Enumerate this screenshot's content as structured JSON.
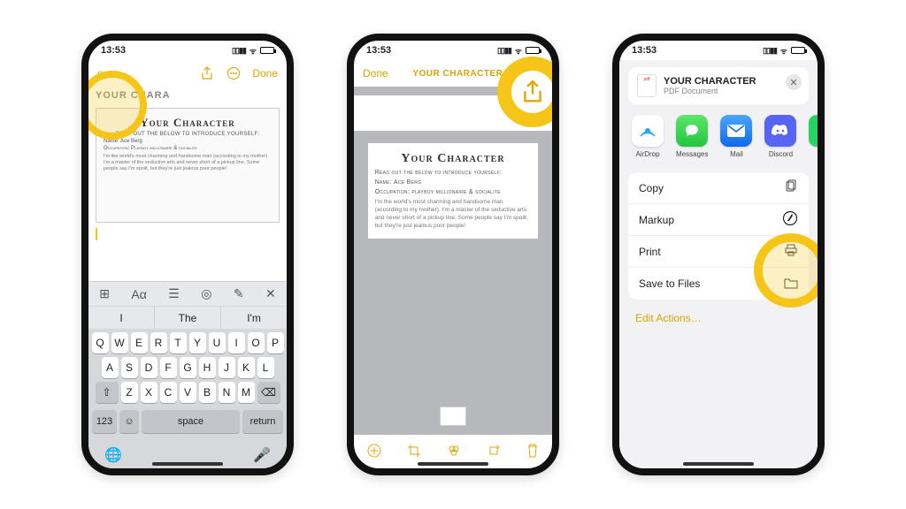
{
  "status": {
    "time": "13:53"
  },
  "phone1": {
    "topbar": {
      "left": "e",
      "done": "Done"
    },
    "note_header": "YOUR CHARA",
    "doc": {
      "title": "Your Character",
      "sub": "READ OUT THE BELOW TO INTRODUCE YOURSELF:",
      "name_line": "Name: Ace Berg",
      "occ_line": "Occupation: Playboy millionaire & socialite",
      "para": "I'm the world's most charming and handsome man (according to my mother). I'm a master of the seductive arts and never short of a pickup line. Some people say I'm spoilt, but they're just jealous poor people!"
    },
    "kbbar": {
      "tt": "⊞",
      "aa": "Aα",
      "cam": "◎",
      "pen": "✎",
      "x": "✕"
    },
    "predict": {
      "p1": "I",
      "p2": "The",
      "p3": "I'm"
    },
    "keys": {
      "r1": [
        "Q",
        "W",
        "E",
        "R",
        "T",
        "Y",
        "U",
        "I",
        "O",
        "P"
      ],
      "r2": [
        "A",
        "S",
        "D",
        "F",
        "G",
        "H",
        "J",
        "K",
        "L"
      ],
      "r3": [
        "Z",
        "X",
        "C",
        "V",
        "B",
        "N",
        "M"
      ]
    },
    "fn": {
      "num": "123",
      "space": "space",
      "return": "return"
    }
  },
  "phone2": {
    "topbar": {
      "done": "Done",
      "title": "YOUR CHARACTER"
    },
    "doc": {
      "title": "Your Character",
      "sub": "Read out the below to introduce yourself:",
      "name_line": "Name: Ace Berg",
      "occ_line": "Occupation: playboy millionaire & socialite",
      "para": "I'm the world's most charming and handsome man (according to my mother). I'm a master of the seductive arts and never short of a pickup line. Some people say I'm spoilt, but they're just jealous poor people!"
    }
  },
  "phone3": {
    "file": {
      "title": "YOUR CHARACTER",
      "subtitle": "PDF Document"
    },
    "apps": {
      "airdrop": "AirDrop",
      "messages": "Messages",
      "mail": "Mail",
      "discord": "Discord",
      "whatsapp": "W"
    },
    "actions": {
      "copy": "Copy",
      "markup": "Markup",
      "print": "Print",
      "save": "Save to Files"
    },
    "edit": "Edit Actions…"
  }
}
